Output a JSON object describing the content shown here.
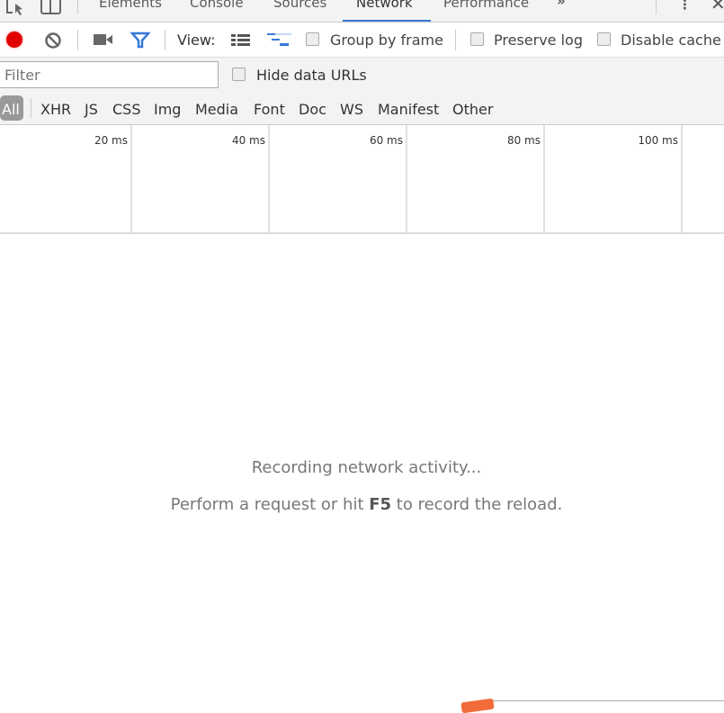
{
  "tabs": [
    {
      "label": "Elements"
    },
    {
      "label": "Console"
    },
    {
      "label": "Sources"
    },
    {
      "label": "Network",
      "active": true
    },
    {
      "label": "Performance"
    }
  ],
  "toolbar": {
    "view_label": "View:",
    "group_by_frame": "Group by frame",
    "preserve_log": "Preserve log",
    "disable_cache": "Disable cache",
    "record_color": "#e00000",
    "filter_icon_color": "#3879d9"
  },
  "filter": {
    "placeholder": "Filter",
    "value": "",
    "hide_data_urls": "Hide data URLs"
  },
  "types": [
    "All",
    "XHR",
    "JS",
    "CSS",
    "Img",
    "Media",
    "Font",
    "Doc",
    "WS",
    "Manifest",
    "Other"
  ],
  "timeline": {
    "ticks": [
      "20 ms",
      "40 ms",
      "60 ms",
      "80 ms",
      "100 ms"
    ]
  },
  "empty": {
    "line1": "Recording network activity...",
    "line2_pre": "Perform a request or hit ",
    "line2_key": "F5",
    "line2_post": " to record the reload."
  }
}
